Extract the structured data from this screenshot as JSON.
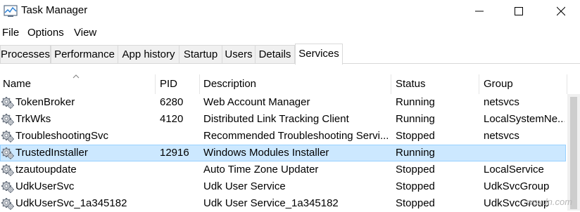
{
  "window": {
    "title": "Task Manager"
  },
  "menu": [
    "File",
    "Options",
    "View"
  ],
  "tabs": [
    "Processes",
    "Performance",
    "App history",
    "Startup",
    "Users",
    "Details",
    "Services"
  ],
  "active_tab": "Services",
  "columns": {
    "name": "Name",
    "pid": "PID",
    "description": "Description",
    "status": "Status",
    "group": "Group"
  },
  "rows": [
    {
      "name": "TokenBroker",
      "pid": "6280",
      "description": "Web Account Manager",
      "status": "Running",
      "group": "netsvcs"
    },
    {
      "name": "TrkWks",
      "pid": "4120",
      "description": "Distributed Link Tracking Client",
      "status": "Running",
      "group": "LocalSystemNe..."
    },
    {
      "name": "TroubleshootingSvc",
      "pid": "",
      "description": "Recommended Troubleshooting Servi...",
      "status": "Stopped",
      "group": "netsvcs"
    },
    {
      "name": "TrustedInstaller",
      "pid": "12916",
      "description": "Windows Modules Installer",
      "status": "Running",
      "group": "",
      "selected": true
    },
    {
      "name": "tzautoupdate",
      "pid": "",
      "description": "Auto Time Zone Updater",
      "status": "Stopped",
      "group": "LocalService"
    },
    {
      "name": "UdkUserSvc",
      "pid": "",
      "description": "Udk User Service",
      "status": "Stopped",
      "group": "UdkSvcGroup"
    },
    {
      "name": "UdkUserSvc_1a345182",
      "pid": "",
      "description": "Udk User Service_1a345182",
      "status": "Stopped",
      "group": "UdkSvcGroup"
    }
  ],
  "watermark": "wsxdn.com",
  "colors": {
    "selected_row": "#cce8ff",
    "selected_border": "#99d1ff",
    "tab_inactive": "#f0f0f0"
  },
  "icons": {
    "app": "task-manager-icon",
    "service": "service-gear-icon"
  }
}
